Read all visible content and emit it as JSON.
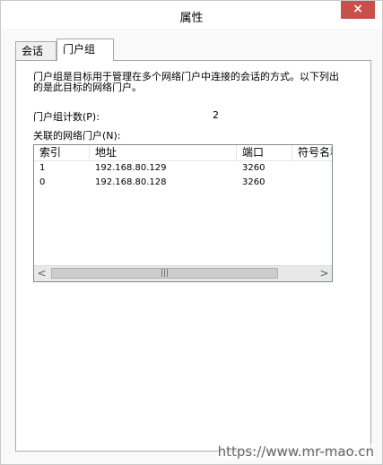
{
  "window": {
    "title": "属性",
    "close_label": "×"
  },
  "tabs": [
    {
      "label": "会话",
      "active": false
    },
    {
      "label": "门户组",
      "active": true
    }
  ],
  "panel": {
    "description": "门户组是目标用于管理在多个网络门户中连接的会话的方式。以下列出的是此目标的网络门户。",
    "count_label": "门户组计数(P):",
    "count_value": "2",
    "list_label": "关联的网络门户(N):",
    "columns": [
      "索引",
      "地址",
      "端口",
      "符号名称"
    ],
    "rows": [
      {
        "index": "1",
        "address": "192.168.80.129",
        "port": "3260",
        "symbol": ""
      },
      {
        "index": "0",
        "address": "192.168.80.128",
        "port": "3260",
        "symbol": ""
      }
    ],
    "scrollbar": {
      "left_arrow": "<",
      "right_arrow": ">",
      "grip": "|||"
    }
  },
  "watermark": "https://www.mr-mao.cn",
  "colors": {
    "close_button": "#c7504a",
    "border": "#a9a9a9"
  }
}
